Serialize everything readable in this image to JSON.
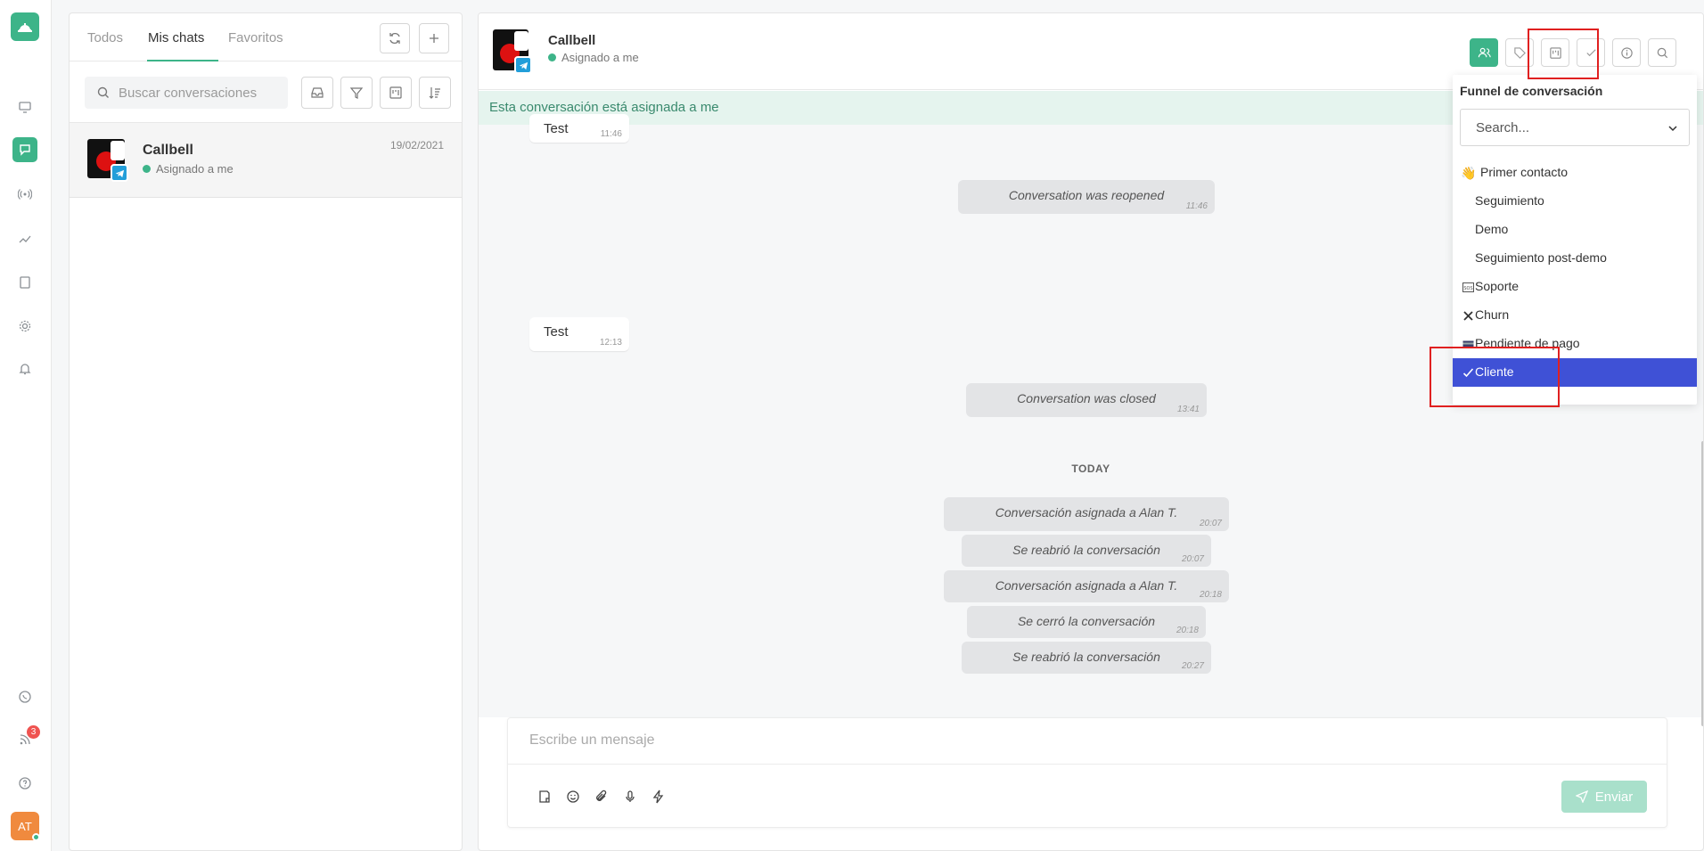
{
  "chat_list": {
    "tabs": [
      {
        "label": "Todos"
      },
      {
        "label": "Mis chats"
      },
      {
        "label": "Favoritos"
      }
    ],
    "search_placeholder": "Buscar conversaciones",
    "conversations": [
      {
        "name": "Callbell",
        "status": "Asignado a me",
        "date": "19/02/2021"
      }
    ]
  },
  "header": {
    "name": "Callbell",
    "status": "Asignado a me"
  },
  "assign_bar": "Esta conversación está asignada a me",
  "messages": {
    "in1": {
      "text": "Test",
      "time": "11:46"
    },
    "sys1": {
      "text": "Conversation was reopened",
      "time": "11:46"
    },
    "in2": {
      "text": "Test",
      "time": "12:13"
    },
    "sys2": {
      "text": "Conversation was closed",
      "time": "13:41"
    },
    "today_label": "TODAY",
    "sys3": {
      "text": "Conversación asignada a Alan T.",
      "time": "20:07"
    },
    "sys4": {
      "text": "Se reabrió la conversación",
      "time": "20:07"
    },
    "sys5": {
      "text": "Conversación asignada a Alan T.",
      "time": "20:18"
    },
    "sys6": {
      "text": "Se cerró la conversación",
      "time": "20:18"
    },
    "sys7": {
      "text": "Se reabrió la conversación",
      "time": "20:27"
    }
  },
  "composer": {
    "placeholder": "Escribe un mensaje",
    "send_label": "Enviar"
  },
  "funnel": {
    "title": "Funnel de conversación",
    "search_placeholder": "Search...",
    "items": [
      {
        "label": "Primer contacto",
        "icon": "waving-hand-icon"
      },
      {
        "label": "Seguimiento",
        "icon": ""
      },
      {
        "label": "Demo",
        "icon": ""
      },
      {
        "label": "Seguimiento post-demo",
        "icon": ""
      },
      {
        "label": "Soporte",
        "icon": "sos-icon"
      },
      {
        "label": "Churn",
        "icon": "x-icon"
      },
      {
        "label": "Pendiente de pago",
        "icon": "card-icon"
      },
      {
        "label": "Cliente",
        "icon": "check-icon",
        "selected": true
      }
    ]
  },
  "nav": {
    "notification_count": "3",
    "user_initials": "AT"
  },
  "colors": {
    "accent": "#3db489",
    "selected": "#3f51d6",
    "highlight": "#e02020",
    "telegram": "#229ed9"
  }
}
